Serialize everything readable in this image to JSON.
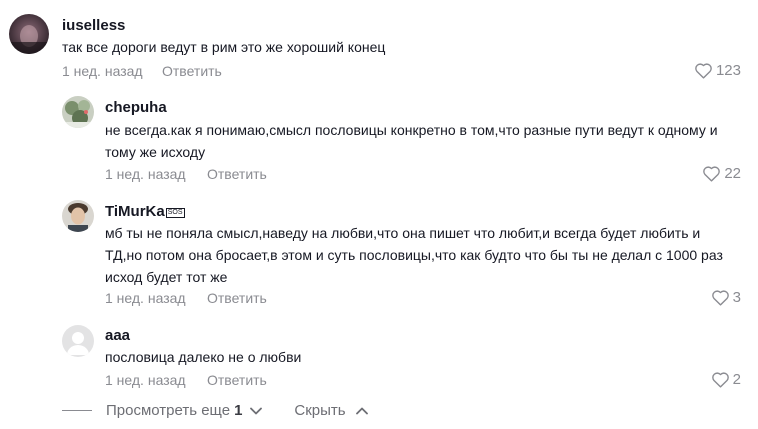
{
  "comments": [
    {
      "author": "iuselless",
      "text": "так все дороги ведут в рим это же хороший конец",
      "time": "1 нед. назад",
      "reply_label": "Ответить",
      "likes": "123"
    },
    {
      "author": "chepuha",
      "text": "не всегда.как я понимаю,смысл пословицы конкретно в том,что разные пути ведут к одному и тому же исходу",
      "time": "1 нед. назад",
      "reply_label": "Ответить",
      "likes": "22"
    },
    {
      "author": "TiMurKa",
      "author_badge": "SOS",
      "text": "мб ты не поняла смысл,наведу на любви,что она пишет что любит,и всегда будет любить и ТД,но потом она бросает,в этом и суть пословицы,что как будто что бы ты не делал с 1000 раз исход будет тот же",
      "time": "1 нед. назад",
      "reply_label": "Ответить",
      "likes": "3"
    },
    {
      "author": "aaa",
      "text": "пословица далеко не о любви",
      "time": "1 нед. назад",
      "reply_label": "Ответить",
      "likes": "2"
    }
  ],
  "footer": {
    "view_more_label": "Просмотреть еще",
    "view_more_count": "1",
    "hide_label": "Скрыть"
  },
  "icons": {
    "like": "heart-outline-icon",
    "expand": "chevron-down-icon",
    "collapse": "chevron-up-icon"
  },
  "colors": {
    "text": "#161823",
    "muted": "#8a8b91"
  }
}
